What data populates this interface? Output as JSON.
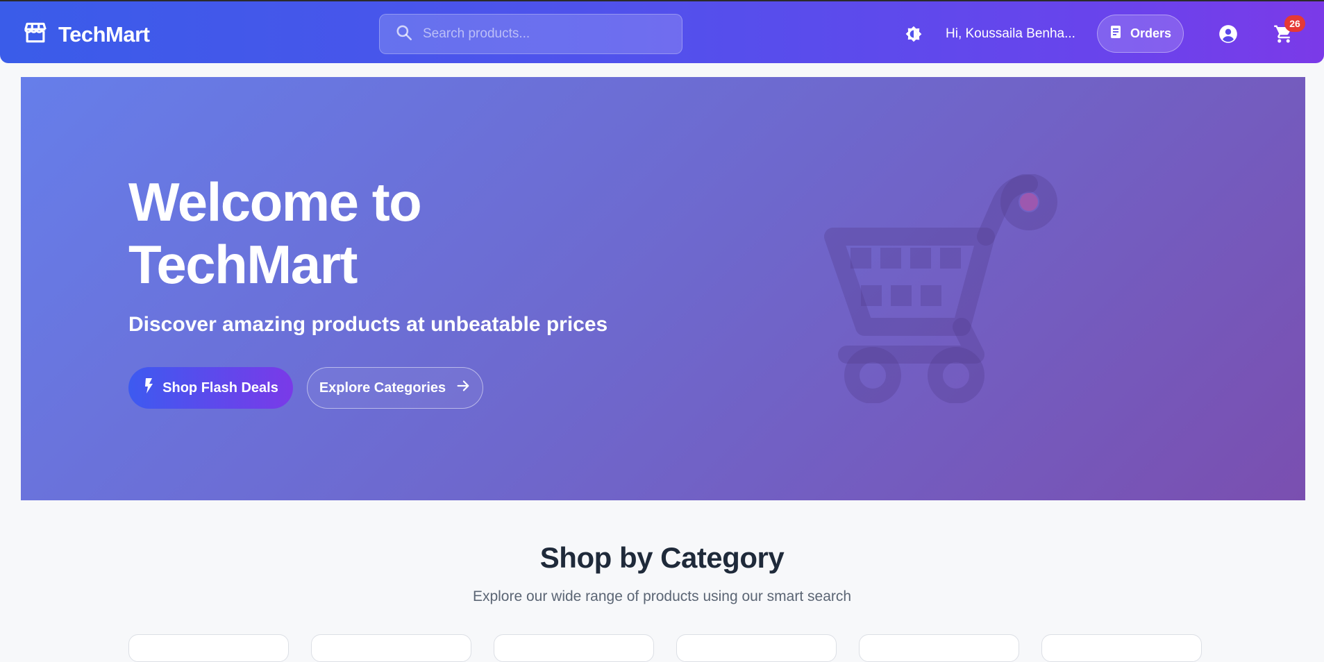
{
  "header": {
    "brand": "TechMart",
    "search_placeholder": "Search products...",
    "greeting": "Hi, Koussaila Benha...",
    "orders_label": "Orders",
    "cart_count": "26"
  },
  "hero": {
    "title": "Welcome to TechMart",
    "subtitle": "Discover amazing products at unbeatable prices",
    "primary_cta": "Shop Flash Deals",
    "secondary_cta": "Explore Categories"
  },
  "categories": {
    "title": "Shop by Category",
    "subtitle": "Explore our wide range of products using our smart search",
    "visible_cards": 6
  },
  "icons": {
    "logo": "store-icon",
    "search": "search-icon",
    "theme": "brightness-icon",
    "orders": "receipt-icon",
    "account": "account-circle-icon",
    "cart": "shopping-cart-icon",
    "flash": "lightning-bolt-icon",
    "arrow": "arrow-right-icon",
    "hero_decoration": "shopping-cart-icon"
  },
  "colors": {
    "header_gradient_start": "#3a5ce9",
    "header_gradient_end": "#7b3ae8",
    "hero_gradient_start": "#667eea",
    "hero_gradient_end": "#7a4fb0",
    "badge": "#e53935",
    "heading_text": "#1f2a3a",
    "muted_text": "#5b6574"
  }
}
